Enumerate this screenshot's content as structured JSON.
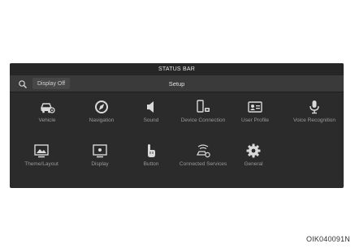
{
  "status_bar": {
    "label": "STATUS BAR"
  },
  "header": {
    "search_icon": "search-icon",
    "display_off_label": "Display Off",
    "title": "Setup"
  },
  "menu": {
    "items": [
      {
        "label": "Vehicle",
        "icon": "car-settings-icon"
      },
      {
        "label": "Navigation",
        "icon": "compass-icon"
      },
      {
        "label": "Sound",
        "icon": "speaker-icon"
      },
      {
        "label": "Device Connection",
        "icon": "phone-connection-icon"
      },
      {
        "label": "User Profile",
        "icon": "profile-card-icon"
      },
      {
        "label": "Voice Recognition",
        "icon": "microphone-icon"
      },
      {
        "label": "Theme/Layout",
        "icon": "theme-layout-icon"
      },
      {
        "label": "Display",
        "icon": "display-icon"
      },
      {
        "label": "Button",
        "icon": "hand-button-icon"
      },
      {
        "label": "Connected Services",
        "icon": "connected-car-icon"
      },
      {
        "label": "General",
        "icon": "gear-icon"
      }
    ]
  },
  "caption": "OIK040091N",
  "colors": {
    "screen_bg": "#2b2b2b",
    "icon": "#d9d9d9",
    "label": "#9a9a9a"
  }
}
